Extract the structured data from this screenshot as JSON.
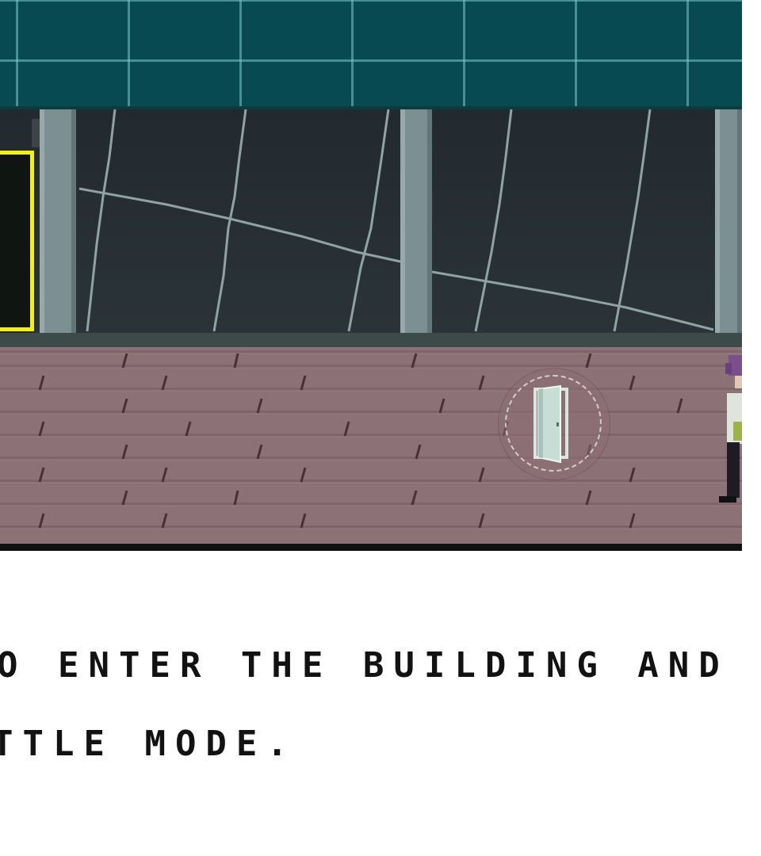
{
  "instruction": {
    "line1": "O ENTER THE BUILDING AND",
    "line2": "TTLE MODE."
  },
  "door_button": {
    "icon": "door-icon"
  },
  "colors": {
    "roof": "#084a52",
    "glass": "#263036",
    "pillar": "#7c8f93",
    "sign_frame": "#f2ef1c",
    "floor": "#8c7177",
    "text": "#121212"
  }
}
